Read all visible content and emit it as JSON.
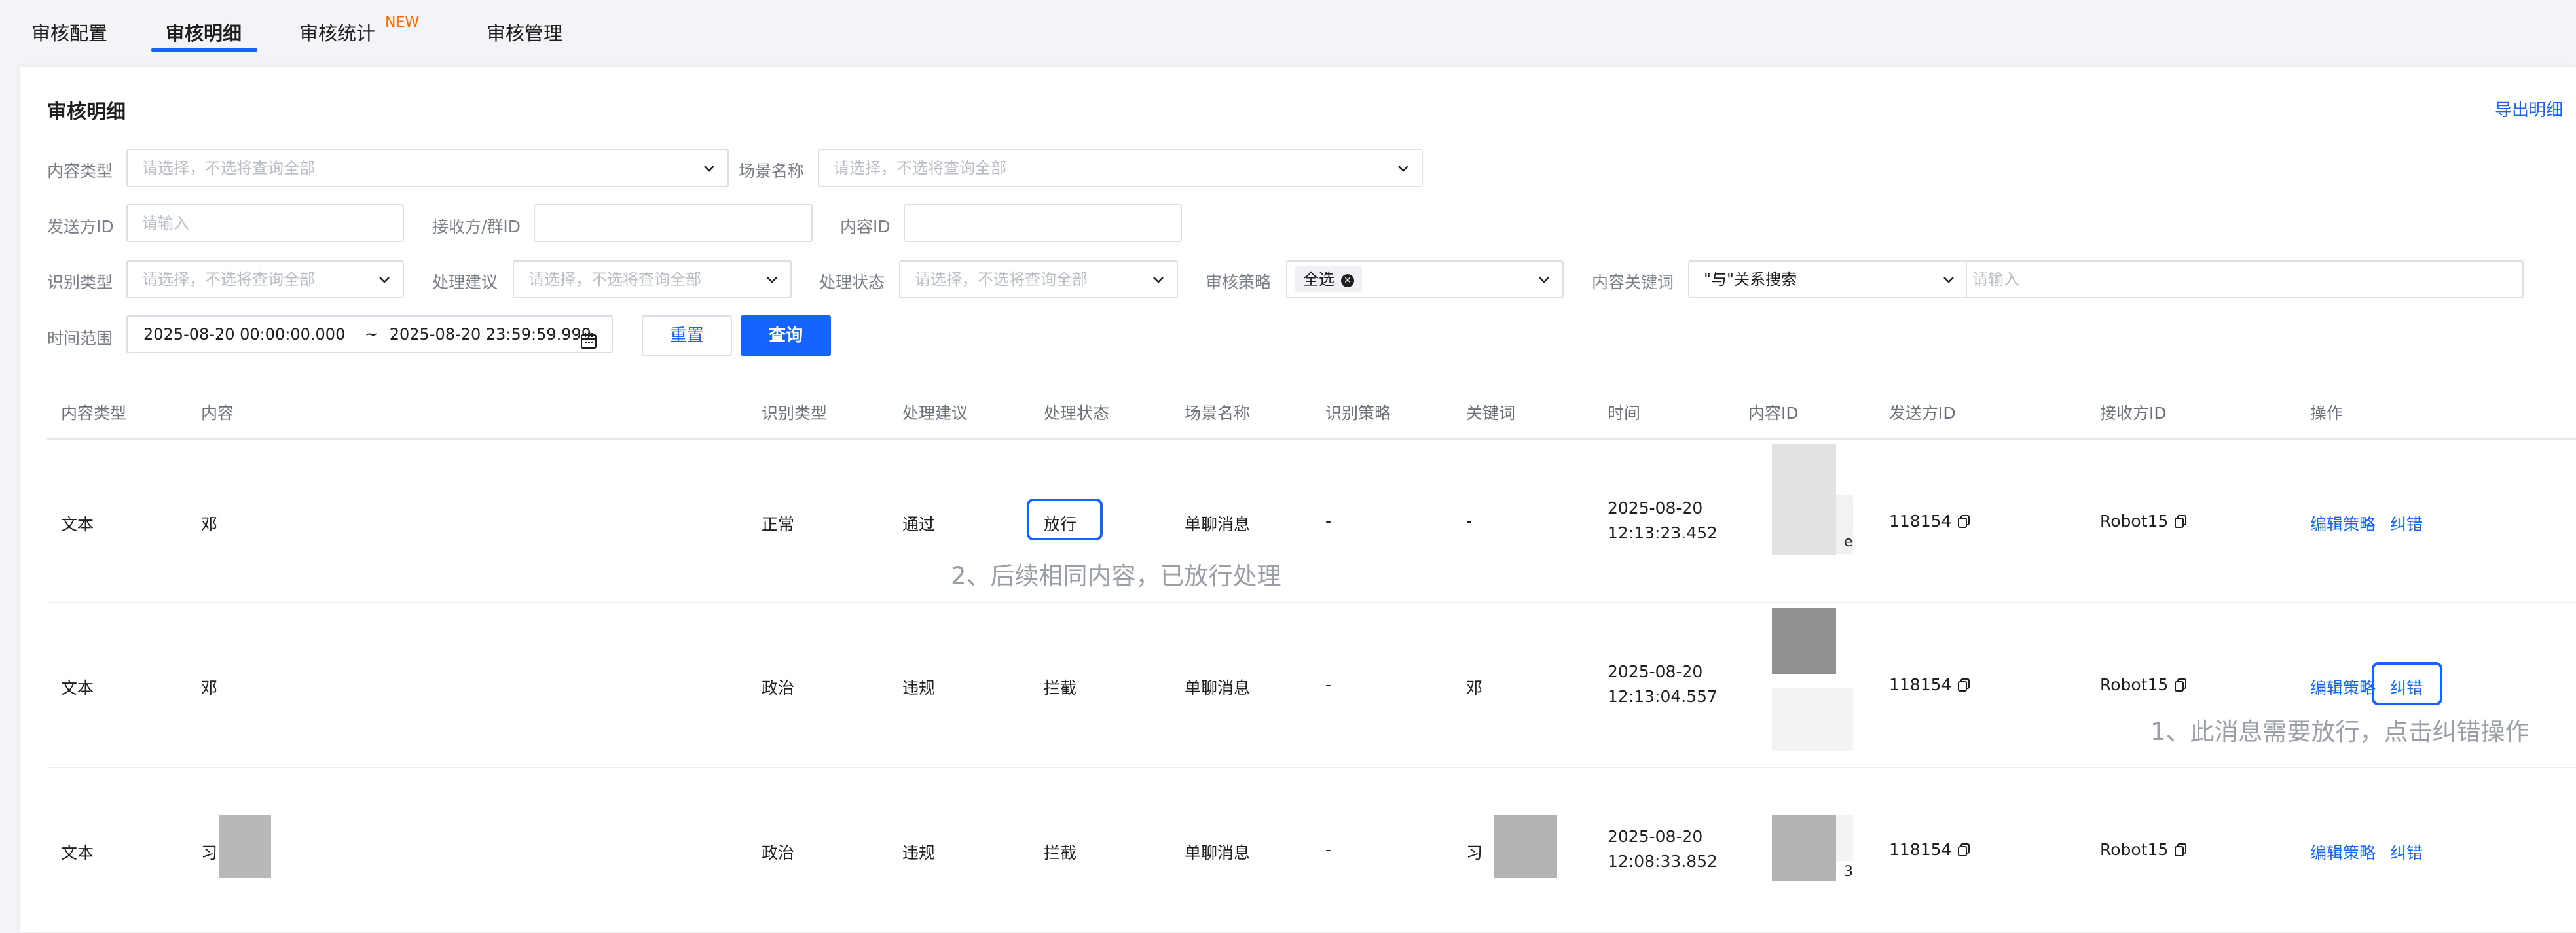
{
  "tabs": [
    {
      "label": "审核配置"
    },
    {
      "label": "审核明细"
    },
    {
      "label": "审核统计"
    },
    {
      "label": "审核管理"
    }
  ],
  "tab_badge": "NEW",
  "panel": {
    "title": "审核明细",
    "export_label": "导出明细"
  },
  "filters": {
    "content_type": {
      "label": "内容类型",
      "placeholder": "请选择，不选将查询全部"
    },
    "scene_name": {
      "label": "场景名称",
      "placeholder": "请选择，不选将查询全部"
    },
    "sender_id": {
      "label": "发送方ID",
      "placeholder": "请输入"
    },
    "receiver_id": {
      "label": "接收方/群ID"
    },
    "content_id": {
      "label": "内容ID"
    },
    "recognition_type": {
      "label": "识别类型",
      "placeholder": "请选择，不选将查询全部"
    },
    "suggestion": {
      "label": "处理建议",
      "placeholder": "请选择，不选将查询全部"
    },
    "status": {
      "label": "处理状态",
      "placeholder": "请选择，不选将查询全部"
    },
    "policy": {
      "label": "审核策略",
      "tag": "全选"
    },
    "keyword": {
      "label": "内容关键词",
      "mode": "\"与\"关系搜索",
      "placeholder": "请输入"
    },
    "time_range": {
      "label": "时间范围",
      "start": "2025-08-20 00:00:00.000",
      "sep": "~",
      "end": "2025-08-20 23:59:59.999"
    }
  },
  "buttons": {
    "reset": "重置",
    "query": "查询"
  },
  "table": {
    "headers": [
      "内容类型",
      "内容",
      "识别类型",
      "处理建议",
      "处理状态",
      "场景名称",
      "识别策略",
      "关键词",
      "时间",
      "内容ID",
      "发送方ID",
      "接收方ID",
      "操作"
    ],
    "rows": [
      {
        "content_type": "文本",
        "content": "邓",
        "recognition_type": "正常",
        "suggestion": "通过",
        "status": "放行",
        "scene": "单聊消息",
        "policy": "-",
        "keyword": "-",
        "date": "2025-08-20",
        "time": "12:13:23.452",
        "content_id_tail": "e",
        "sender": "118154",
        "receiver": "Robot15",
        "action_edit": "编辑策略",
        "action_fix": "纠错"
      },
      {
        "content_type": "文本",
        "content": "邓",
        "recognition_type": "政治",
        "suggestion": "违规",
        "status": "拦截",
        "scene": "单聊消息",
        "policy": "-",
        "keyword": "邓",
        "date": "2025-08-20",
        "time": "12:13:04.557",
        "content_id_tail": "",
        "sender": "118154",
        "receiver": "Robot15",
        "action_edit": "编辑策略",
        "action_fix": "纠错"
      },
      {
        "content_type": "文本",
        "content": "习",
        "recognition_type": "政治",
        "suggestion": "违规",
        "status": "拦截",
        "scene": "单聊消息",
        "policy": "-",
        "keyword": "习",
        "date": "2025-08-20",
        "time": "12:08:33.852",
        "content_id_tail": "3",
        "sender": "118154",
        "receiver": "Robot15",
        "action_edit": "编辑策略",
        "action_fix": "纠错"
      }
    ]
  },
  "annotations": {
    "first": "1、此消息需要放行，点击纠错操作",
    "second": "2、后续相同内容，已放行处理"
  },
  "colors": {
    "accent": "#1664ff",
    "badge": "#ff6a00",
    "annotation": "#9a9ea6"
  },
  "icons": [
    "chevron-down-icon",
    "calendar-icon",
    "clear-tag-icon",
    "copy-icon"
  ]
}
